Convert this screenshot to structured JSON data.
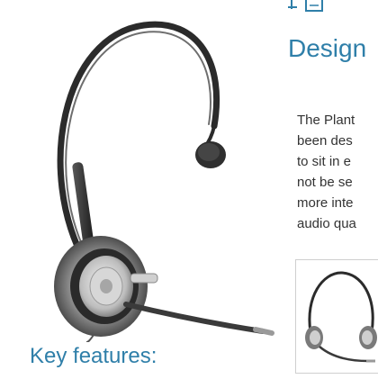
{
  "hero": {
    "image_icon": "monaural-headset-icon"
  },
  "top_icons": [
    "link-icon",
    "document-icon"
  ],
  "design_section": {
    "heading": "Design",
    "body_lines": [
      "The Plant",
      "been des",
      "to sit in e",
      "not be se",
      "more inte",
      "audio qua"
    ],
    "thumbnail_icon": "binaural-headset-icon"
  },
  "key_features": {
    "heading": "Key features:"
  },
  "colors": {
    "heading": "#2f7fa9",
    "text": "#333333",
    "border": "#cfcfcf"
  }
}
